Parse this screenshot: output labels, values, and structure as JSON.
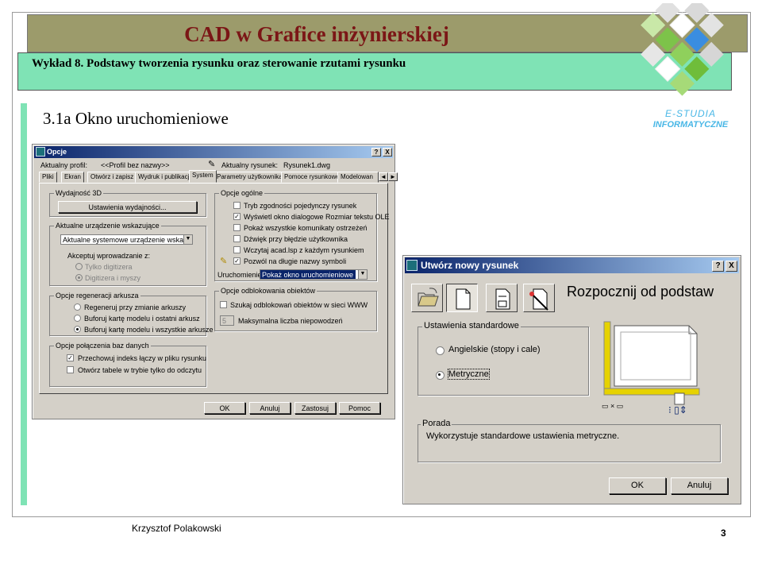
{
  "slide": {
    "course_title": "CAD w Grafice inżynierskiej",
    "lecture_title": "Wykład 8.  Podstawy tworzenia rysunku oraz sterowanie rzutami rysunku",
    "section_title": "3.1a Okno uruchomieniowe",
    "logo_line1": "E-STUDIA",
    "logo_line2": "INFORMATYCZNE",
    "author": "Krzysztof Polakowski",
    "page_number": "3",
    "colors": {
      "header": "#9c9b6b",
      "subtitle": "#7fe3b5",
      "title_text": "#7b1616",
      "logo_blue": "#49b7e6"
    }
  },
  "options_dialog": {
    "title": "Opcje",
    "help_btn": "?",
    "close_btn": "X",
    "profile_label": "Aktualny profil:",
    "profile_value": "<<Profil bez nazwy>>",
    "drawing_label": "Aktualny rysunek:",
    "drawing_value": "Rysunek1.dwg",
    "tabs": [
      "Pliki",
      "Ekran",
      "Otwórz i zapisz",
      "Wydruk i publikacja",
      "System",
      "Parametry użytkownika",
      "Pomoce rysunkowe",
      "Modelowan"
    ],
    "tab_prev": "◄",
    "tab_next": "►",
    "perf_group": "Wydajność 3D",
    "perf_button": "Ustawienia wydajności...",
    "pointing_group": "Aktualne urządzenie wskazujące",
    "pointing_value": "Aktualne systemowe urządzenie wskazujące",
    "accept_label": "Akceptuj wprowadzanie z:",
    "accept_opt1": "Tylko digitizera",
    "accept_opt2": "Digitizera i myszy",
    "regen_group": "Opcje regeneracji arkusza",
    "regen_opt1": "Regeneruj przy zmianie arkuszy",
    "regen_opt2": "Buforuj kartę modelu i ostatni arkusz",
    "regen_opt3": "Buforuj kartę modelu i wszystkie arkusze",
    "db_group": "Opcje połączenia baz danych",
    "db_opt1": "Przechowuj indeks łączy w pliku rysunku",
    "db_opt2": "Otwórz tabele w trybie tylko do odczytu",
    "general_group": "Opcje ogólne",
    "gen_opt1": "Tryb zgodności pojedynczy rysunek",
    "gen_opt2": "Wyświetl okno dialogowe Rozmiar tekstu OLE",
    "gen_opt3": "Pokaż wszystkie komunikaty ostrzeżeń",
    "gen_opt4": "Dźwięk przy błędzie użytkownika",
    "gen_opt5": "Wczytaj acad.lsp z każdym rysunkiem",
    "gen_opt6": "Pozwól na długie nazwy symboli",
    "startup_label": "Uruchomienie:",
    "startup_value": "Pokaż okno uruchomieniowe",
    "unlock_group": "Opcje odblokowania obiektów",
    "unlock_opt1": "Szukaj odblokowań obiektów w sieci WWW",
    "unlock_num": "5",
    "unlock_max": "Maksymalna liczba niepowodzeń",
    "ok": "OK",
    "cancel": "Anuluj",
    "apply": "Zastosuj",
    "help": "Pomoc"
  },
  "new_dialog": {
    "title": "Utwórz nowy rysunek",
    "help_btn": "?",
    "close_btn": "X",
    "header": "Rozpocznij od podstaw",
    "std_group": "Ustawienia standardowe",
    "opt1": "Angielskie (stopy i cale)",
    "opt2": "Metryczne",
    "tip_group": "Porada",
    "tip_text": "Wykorzystuje standardowe ustawienia metryczne.",
    "ok": "OK",
    "cancel": "Anuluj"
  }
}
